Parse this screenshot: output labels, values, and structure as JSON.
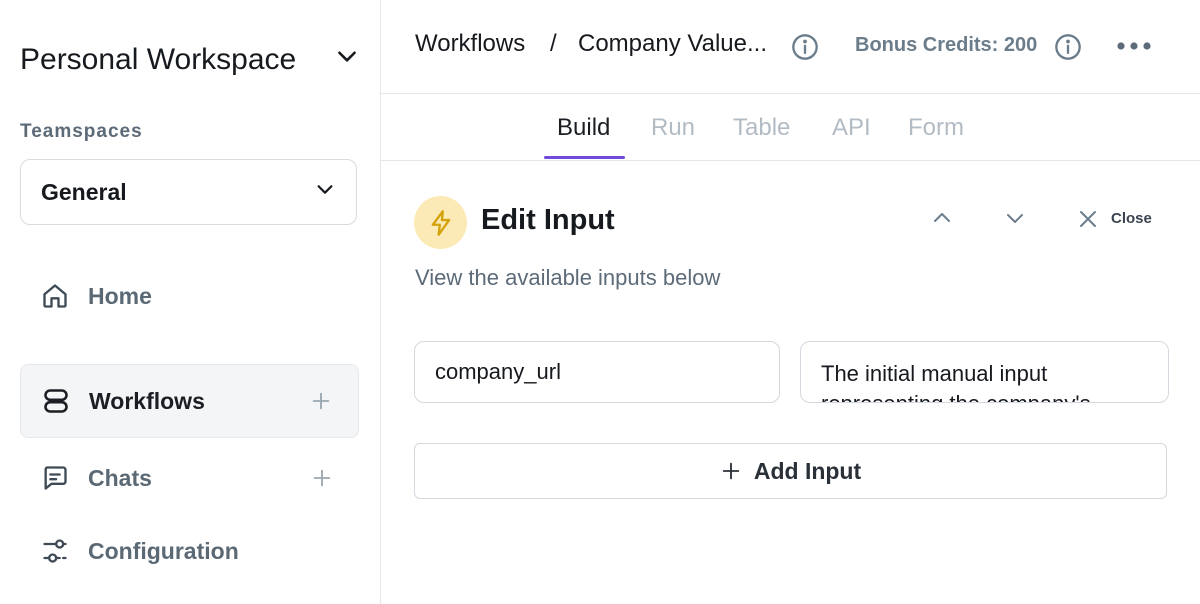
{
  "sidebar": {
    "workspace_title": "Personal Workspace",
    "teamspaces_label": "Teamspaces",
    "teamspace_selected": "General",
    "items": [
      {
        "label": "Home",
        "icon": "home-icon"
      },
      {
        "label": "Workflows",
        "icon": "workflows-icon",
        "active": true,
        "addable": true
      },
      {
        "label": "Chats",
        "icon": "chat-icon",
        "addable": true
      },
      {
        "label": "Configuration",
        "icon": "sliders-icon"
      }
    ]
  },
  "header": {
    "breadcrumb_root": "Workflows",
    "breadcrumb_separator": "/",
    "breadcrumb_current": "Company Value...",
    "credits": "Bonus Credits: 200"
  },
  "tabs": [
    {
      "label": "Build",
      "active": true
    },
    {
      "label": "Run"
    },
    {
      "label": "Table"
    },
    {
      "label": "API"
    },
    {
      "label": "Form"
    }
  ],
  "panel": {
    "title": "Edit Input",
    "subtitle": "View the available inputs below",
    "close_label": "Close",
    "input_name_value": "company_url",
    "input_description_value": "The initial manual input representing the company's",
    "add_input_label": "Add Input"
  },
  "colors": {
    "accent": "#6e4bd8",
    "bolt_badge_bg": "#fbe9b6",
    "bolt": "#d4a20b",
    "muted_text": "#5d6b78"
  }
}
